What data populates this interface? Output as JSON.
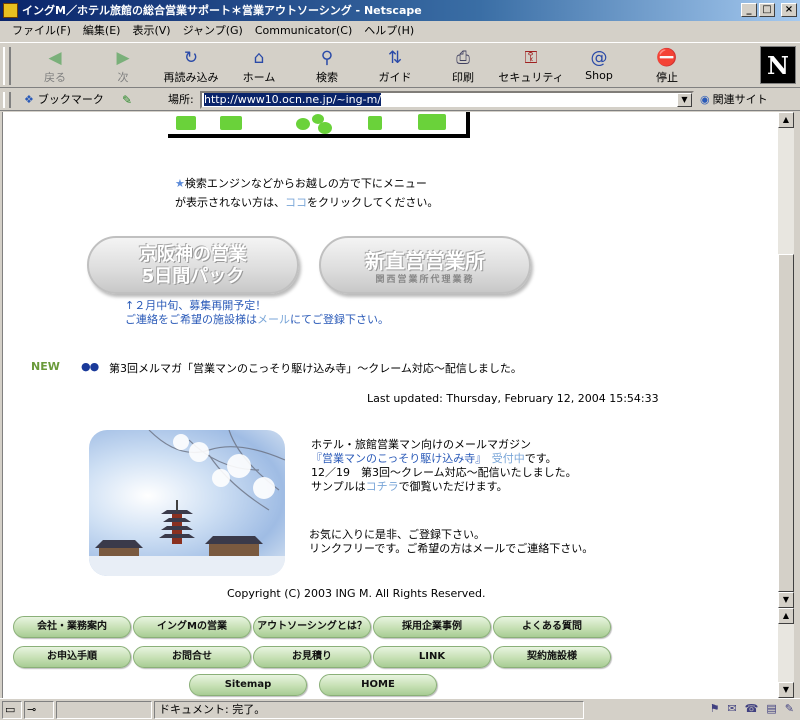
{
  "window": {
    "title": "イングM／ホテル旅館の総合営業サポート＊営業アウトソーシング - Netscape",
    "minimize": "_",
    "maximize": "□",
    "close": "×"
  },
  "menu": [
    "ファイル(F)",
    "編集(E)",
    "表示(V)",
    "ジャンプ(G)",
    "Communicator(C)",
    "ヘルプ(H)"
  ],
  "toolbar": {
    "buttons": [
      {
        "label": "戻る",
        "icon": "back-arrow"
      },
      {
        "label": "次",
        "icon": "forward-arrow"
      },
      {
        "label": "再読み込み",
        "icon": "reload"
      },
      {
        "label": "ホーム",
        "icon": "home"
      },
      {
        "label": "検索",
        "icon": "search"
      },
      {
        "label": "ガイド",
        "icon": "guide"
      },
      {
        "label": "印刷",
        "icon": "print"
      },
      {
        "label": "セキュリティ",
        "icon": "security"
      },
      {
        "label": "Shop",
        "icon": "shop"
      },
      {
        "label": "停止",
        "icon": "stop"
      }
    ],
    "logo": "N"
  },
  "location": {
    "bookmark_label": "ブックマーク",
    "label": "場所:",
    "url": "http://www10.ocn.ne.jp/~ing-m/",
    "related_label": "関連サイト"
  },
  "page": {
    "search_note_line1": "検索エンジンなどからお越しの方で下にメニュー",
    "search_note_line2_pre": "が表示されない方は、",
    "search_note_link": "ココ",
    "search_note_line2_post": "をクリックしてください。",
    "promo_left_line1": "京阪神の営業",
    "promo_left_line2": "5日間パック",
    "promo_right_line1": "新直営営業所",
    "promo_right_sub": "関西営業所代理業務",
    "recruit_line1": "↑２月中旬、募集再開予定！",
    "recruit_line2_pre": "ご連絡をご希望の施設様は",
    "recruit_line2_link": "メール",
    "recruit_line2_post": "にてご登録下さい。",
    "new_badge": "NEW",
    "news_dots": "●●",
    "news_text": "第3回メルマガ「営業マンのこっそり駆け込み寺」～クレーム対応～配信しました。",
    "last_updated": "Last updated: Thursday, February 12, 2004 15:54:33",
    "mag_line1": "ホテル・旅館営業マン向けのメールマガジン",
    "mag_line2_title": "『営業マンのこっそり駆け込み寺』",
    "mag_line2_link": "受付中",
    "mag_line2_post": "です。",
    "mag_line3": "12／19　第3回～クレーム対応～配信いたしました。",
    "mag_line4_pre": "サンプルは",
    "mag_line4_link": "コチラ",
    "mag_line4_post": "で御覧いただけます。",
    "fav_line1": "お気に入りに是非、ご登録下さい。",
    "fav_line2": "リンクフリーです。ご希望の方はメールでご連絡下さい。",
    "copyright": "Copyright (C) 2003 ING M. All Rights Reserved."
  },
  "nav": {
    "row1": [
      "会社・業務案内",
      "イングMの営業",
      "アウトソーシングとは？",
      "採用企業事例",
      "よくある質問"
    ],
    "row2": [
      "お申込手順",
      "お問合せ",
      "お見積り",
      "LINK",
      "契約施設様"
    ],
    "row3": [
      "Sitemap",
      "HOME"
    ]
  },
  "status": {
    "text": "ドキュメント: 完了。"
  }
}
